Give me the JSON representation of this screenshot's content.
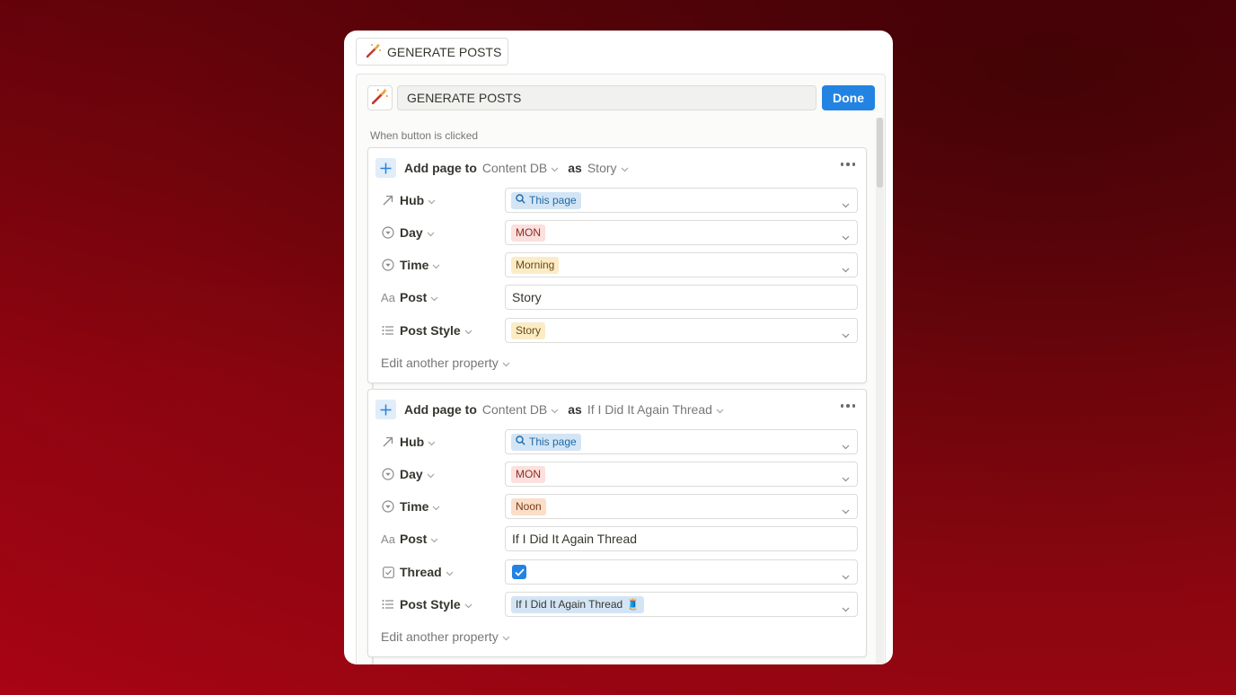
{
  "top_button": {
    "label": "GENERATE POSTS",
    "icon": "magic-wand-icon"
  },
  "editor": {
    "name_value": "GENERATE POSTS",
    "done_label": "Done",
    "trigger_label": "When button is clicked"
  },
  "actions": [
    {
      "verb": "Add page to",
      "database": "Content DB",
      "as_label": "as",
      "template": "Story",
      "properties": [
        {
          "icon": "relation-arrow-icon",
          "name": "Hub",
          "type": "relation",
          "value": "This page"
        },
        {
          "icon": "select-icon",
          "name": "Day",
          "type": "select",
          "value": "MON",
          "color": "#fbe0dd"
        },
        {
          "icon": "select-icon",
          "name": "Time",
          "type": "select",
          "value": "Morning",
          "color": "#fbecc7"
        },
        {
          "icon": "title-icon",
          "name": "Post",
          "type": "text",
          "value": "Story"
        },
        {
          "icon": "list-icon",
          "name": "Post Style",
          "type": "select",
          "value": "Story",
          "color": "#fbecc7"
        }
      ],
      "edit_another": "Edit another property"
    },
    {
      "verb": "Add page to",
      "database": "Content DB",
      "as_label": "as",
      "template": "If I Did It Again Thread",
      "properties": [
        {
          "icon": "relation-arrow-icon",
          "name": "Hub",
          "type": "relation",
          "value": "This page"
        },
        {
          "icon": "select-icon",
          "name": "Day",
          "type": "select",
          "value": "MON",
          "color": "#fbe0dd"
        },
        {
          "icon": "select-icon",
          "name": "Time",
          "type": "select",
          "value": "Noon",
          "color": "#fadec9"
        },
        {
          "icon": "title-icon",
          "name": "Post",
          "type": "text",
          "value": "If I Did It Again Thread"
        },
        {
          "icon": "checkbox-icon",
          "name": "Thread",
          "type": "checkbox",
          "value": "checked"
        },
        {
          "icon": "list-icon",
          "name": "Post Style",
          "type": "select",
          "value": "If I Did It Again Thread",
          "emoji": "🧵",
          "color": "#d3e5f5"
        }
      ],
      "edit_another": "Edit another property"
    }
  ],
  "colors": {
    "accent": "#2383e2",
    "background": "#8e0610"
  }
}
